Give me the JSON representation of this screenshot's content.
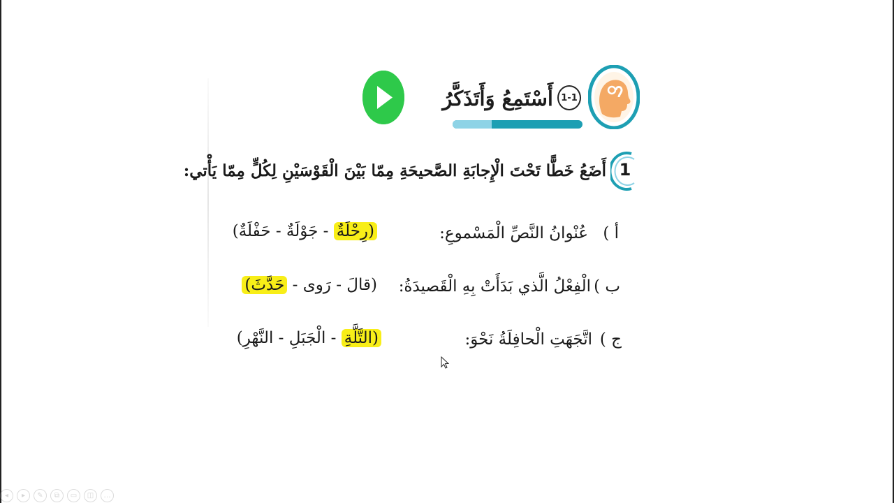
{
  "header": {
    "section_title": "أَسْتَمِعُ وَأَتَذَكَّرُ",
    "section_number": "1-1",
    "play_icon": "play-icon",
    "head_icon": "listening-head-icon",
    "colors": {
      "play": "#2ec94a",
      "teal": "#1d9fb3",
      "light_teal": "#8ed3e6",
      "head": "#f4a964"
    }
  },
  "question": {
    "number": "1",
    "instruction": "أَضَعُ خَطًّا تَحْتَ الْإِجابَةِ الصَّحيحَةِ مِمّا بَيْنَ الْقَوْسَيْنِ لِكُلٍّ مِمّا يَأْتي:"
  },
  "items": [
    {
      "label": "أ )",
      "prompt": "عُنْوانُ النَّصِّ الْمَسْموعِ:",
      "choices_before": "",
      "choice_highlight": "(رِحْلَةٌ",
      "choices_after": " - جَوْلَةٌ - حَفْلَةٌ)"
    },
    {
      "label": "ب )",
      "prompt": "الْفِعْلُ الَّذي بَدَأَتْ بِهِ الْقَصيدَةُ:",
      "choices_before": "(قالَ - رَوى - ",
      "choice_highlight": "حَدَّثَ)",
      "choices_after": ""
    },
    {
      "label": "ج )",
      "prompt": "اتَّجَهَتِ الْحافِلَةُ نَحْوَ:",
      "choices_before": "",
      "choice_highlight": "(التَّلَّةِ",
      "choices_after": " - الْجَبَلِ - النَّهْرِ)"
    }
  ],
  "highlight_color": "#f8ee18",
  "toolbar": {
    "buttons": [
      "previous-icon",
      "play-icon",
      "pen-icon",
      "copy-icon",
      "slides-icon",
      "camera-icon",
      "more-icon"
    ],
    "glyphs": [
      "◂",
      "▸",
      "✎",
      "⧉",
      "▭",
      "◫",
      "…"
    ]
  }
}
